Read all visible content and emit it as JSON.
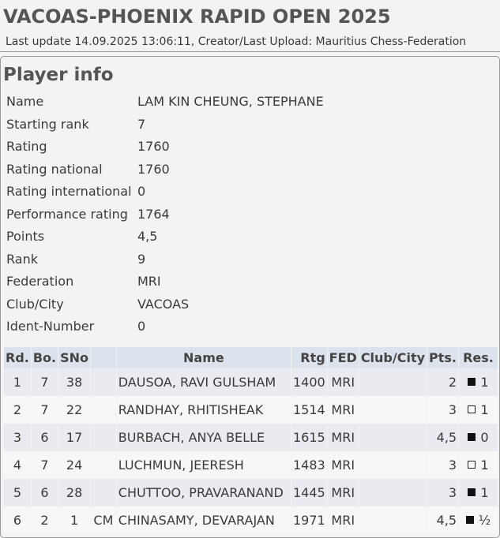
{
  "header": {
    "title": "VACOAS-PHOENIX RAPID OPEN 2025",
    "subtitle": "Last update 14.09.2025 13:06:11, Creator/Last Upload: Mauritius Chess-Federation"
  },
  "player_info": {
    "title": "Player info",
    "rows": [
      {
        "label": "Name",
        "value": "LAM KIN CHEUNG, STEPHANE"
      },
      {
        "label": "Starting rank",
        "value": "7"
      },
      {
        "label": "Rating",
        "value": "1760"
      },
      {
        "label": "Rating national",
        "value": "1760"
      },
      {
        "label": "Rating international",
        "value": "0"
      },
      {
        "label": "Performance rating",
        "value": "1764"
      },
      {
        "label": "Points",
        "value": "4,5"
      },
      {
        "label": "Rank",
        "value": "9"
      },
      {
        "label": "Federation",
        "value": "MRI"
      },
      {
        "label": "Club/City",
        "value": "VACOAS"
      },
      {
        "label": "Ident-Number",
        "value": "0"
      }
    ]
  },
  "games": {
    "headers": [
      "Rd.",
      "Bo.",
      "SNo",
      "",
      "Name",
      "Rtg",
      "FED",
      "Club/City",
      "Pts.",
      "Res."
    ],
    "rows": [
      {
        "rd": "1",
        "bo": "7",
        "sno": "38",
        "title": "",
        "name": "DAUSOA, RAVI GULSHAM",
        "rtg": "1400",
        "fed": "MRI",
        "club": "",
        "pts": "2",
        "color": "black",
        "res": "1"
      },
      {
        "rd": "2",
        "bo": "7",
        "sno": "22",
        "title": "",
        "name": "RANDHAY, RHITISHEAK",
        "rtg": "1514",
        "fed": "MRI",
        "club": "",
        "pts": "3",
        "color": "white",
        "res": "1"
      },
      {
        "rd": "3",
        "bo": "6",
        "sno": "17",
        "title": "",
        "name": "BURBACH, ANYA BELLE",
        "rtg": "1615",
        "fed": "MRI",
        "club": "",
        "pts": "4,5",
        "color": "black",
        "res": "0"
      },
      {
        "rd": "4",
        "bo": "7",
        "sno": "24",
        "title": "",
        "name": "LUCHMUN, JEERESH",
        "rtg": "1483",
        "fed": "MRI",
        "club": "",
        "pts": "3",
        "color": "white",
        "res": "1"
      },
      {
        "rd": "5",
        "bo": "6",
        "sno": "28",
        "title": "",
        "name": "CHUTTOO, PRAVARANAND",
        "rtg": "1445",
        "fed": "MRI",
        "club": "",
        "pts": "3",
        "color": "black",
        "res": "1"
      },
      {
        "rd": "6",
        "bo": "2",
        "sno": "1",
        "title": "CM",
        "name": "CHINASAMY, DEVARAJAN",
        "rtg": "1971",
        "fed": "MRI",
        "club": "",
        "pts": "4,5",
        "color": "black",
        "res": "½"
      }
    ]
  }
}
